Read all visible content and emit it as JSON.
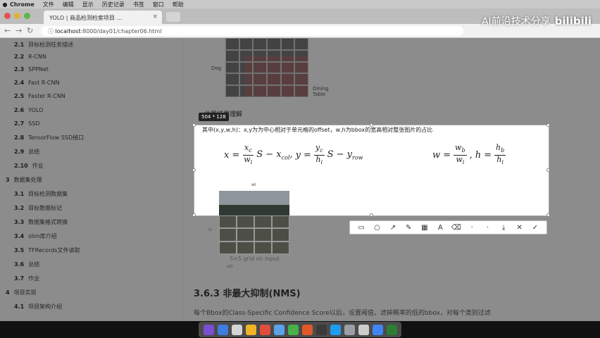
{
  "menubar": {
    "apple": "",
    "items": [
      "Chrome",
      "文件",
      "编辑",
      "显示",
      "历史记录",
      "书签",
      "窗口",
      "帮助"
    ]
  },
  "tab": {
    "title": "YOLO | 商品检测检索项目 ...",
    "close": "×"
  },
  "url": {
    "scheme": "",
    "host": "localhost",
    "rest": ":8000/day01/chapter06.html"
  },
  "watermark": {
    "text": "AI前沿技术分享",
    "logo": "bilibili"
  },
  "sidebar": {
    "items": [
      {
        "num": "2.1",
        "label": "目标检测任务描述"
      },
      {
        "num": "2.2",
        "label": "R-CNN"
      },
      {
        "num": "2.3",
        "label": "SPPNet"
      },
      {
        "num": "2.4",
        "label": "Fast R-CNN"
      },
      {
        "num": "2.5",
        "label": "Faster R-CNN"
      },
      {
        "num": "2.6",
        "label": "YOLO"
      },
      {
        "num": "2.7",
        "label": "SSD"
      },
      {
        "num": "2.8",
        "label": "TensorFlow SSD接口"
      },
      {
        "num": "2.9",
        "label": "总结"
      },
      {
        "num": "2.10",
        "label": "作业"
      },
      {
        "num": "3",
        "label": "数据集处理",
        "top": true
      },
      {
        "num": "3.1",
        "label": "目标检测数据集"
      },
      {
        "num": "3.2",
        "label": "目标数据标记"
      },
      {
        "num": "3.3",
        "label": "数据集格式转换"
      },
      {
        "num": "3.4",
        "label": "slim库介绍"
      },
      {
        "num": "3.5",
        "label": "TFRecords文件读取"
      },
      {
        "num": "3.6",
        "label": "总结"
      },
      {
        "num": "3.7",
        "label": "作业"
      },
      {
        "num": "4",
        "label": "项目实现",
        "top": true
      },
      {
        "num": "4.1",
        "label": "项目架构介绍"
      }
    ]
  },
  "figure": {
    "dog_label": "Dog",
    "table_label": "Dining\nTable"
  },
  "section": {
    "subheading": "位置结果理解"
  },
  "selection": {
    "size_tag": "504 * 128",
    "text": "其中(x,y,w,h)：x,y为为中心相对于单元格的offset，w,h为bbox的宽高相对整张图片的占比",
    "formula_left": {
      "x_var": "x",
      "eq": "=",
      "num": "x",
      "num_sub": "c",
      "den": "w",
      "den_sub": "i",
      "tail": "S − x",
      "tail_sub": "col",
      "sep": ",",
      "y_var": "y",
      "eq2": "=",
      "num2": "y",
      "num2_sub": "c",
      "den2": "h",
      "den2_sub": "i",
      "tail2": "S − y",
      "tail2_sub": "row"
    },
    "formula_right": {
      "w_var": "w",
      "eq": "=",
      "num": "w",
      "num_sub": "b",
      "den": "w",
      "den_sub": "i",
      "sep": ",",
      "h_var": "h",
      "eq2": "=",
      "num2": "h",
      "num2_sub": "b",
      "den2": "h",
      "den2_sub": "i"
    }
  },
  "photo": {
    "top_label": "wi",
    "side_label": "hi",
    "caption": "S×S grid on input",
    "bottom_label": "wb"
  },
  "annotation_toolbar": {
    "tools": [
      "▭",
      "○",
      "↗",
      "✎",
      "▦",
      "A",
      "⌫",
      "·",
      "·",
      "⤓",
      "✕",
      "✓"
    ]
  },
  "content": {
    "heading": "3.6.3 非最大抑制(NMS)",
    "paragraph": "每个Bbox的Class-Specific Confidence Score以后，设置阈值，滤掉概率的低的bbox，对每个类别过滤"
  },
  "colors": {
    "menubar": "#c9c9c9",
    "page": "#ffffff",
    "dock": "#4b4b4b",
    "grid_highlight": "#c26b70"
  }
}
